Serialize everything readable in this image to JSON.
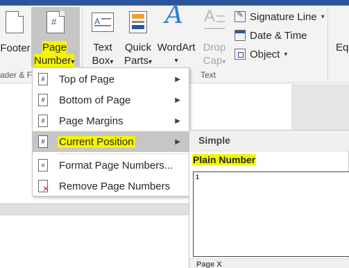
{
  "ribbon": {
    "footer_label": "Footer",
    "page_number_label_line1": "Page",
    "page_number_label_line2": "Number",
    "text_box_line1": "Text",
    "text_box_line2": "Box",
    "quick_parts_line1": "Quick",
    "quick_parts_line2": "Parts",
    "wordart_label": "WordArt",
    "drop_cap_line1": "Drop",
    "drop_cap_line2": "Cap",
    "signature_line_label": "Signature Line",
    "date_time_label": "Date & Time",
    "object_label": "Object",
    "equation_partial": "Eq",
    "group_header_footer_partial": "ader & F",
    "group_text": "Text",
    "caret": "▾"
  },
  "page_number_menu": {
    "items": [
      {
        "label": "Top of Page",
        "icon": "page-number-icon",
        "has_submenu": true
      },
      {
        "label": "Bottom of Page",
        "icon": "page-number-icon",
        "has_submenu": true
      },
      {
        "label": "Page Margins",
        "icon": "page-number-icon",
        "has_submenu": true
      },
      {
        "label": "Current Position",
        "icon": "page-number-icon",
        "has_submenu": true,
        "active": true
      },
      {
        "label": "Format Page Numbers...",
        "icon": "format-page-numbers-icon",
        "has_submenu": false
      },
      {
        "label": "Remove Page Numbers",
        "icon": "remove-page-numbers-icon",
        "has_submenu": false
      }
    ],
    "arrow": "▶"
  },
  "gallery": {
    "section_header": "Simple",
    "item_label": "Plain Number",
    "preview_number": "1",
    "next_section_partial": "Page X"
  },
  "colors": {
    "highlight": "#f5f500",
    "accent": "#2b579a",
    "active_item": "#c6c6c6"
  }
}
